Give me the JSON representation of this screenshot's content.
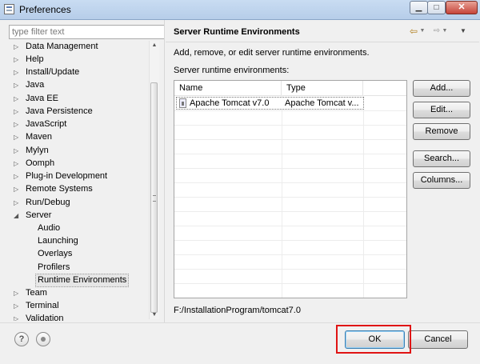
{
  "window": {
    "title": "Preferences",
    "min": "▁",
    "max": "□",
    "close": "✕"
  },
  "filter": {
    "placeholder": "type filter text"
  },
  "tree": {
    "items": [
      {
        "label": "Data Management",
        "arrow": "▷"
      },
      {
        "label": "Help",
        "arrow": "▷"
      },
      {
        "label": "Install/Update",
        "arrow": "▷"
      },
      {
        "label": "Java",
        "arrow": "▷"
      },
      {
        "label": "Java EE",
        "arrow": "▷"
      },
      {
        "label": "Java Persistence",
        "arrow": "▷"
      },
      {
        "label": "JavaScript",
        "arrow": "▷"
      },
      {
        "label": "Maven",
        "arrow": "▷"
      },
      {
        "label": "Mylyn",
        "arrow": "▷"
      },
      {
        "label": "Oomph",
        "arrow": "▷"
      },
      {
        "label": "Plug-in Development",
        "arrow": "▷"
      },
      {
        "label": "Remote Systems",
        "arrow": "▷"
      },
      {
        "label": "Run/Debug",
        "arrow": "▷"
      },
      {
        "label": "Server",
        "arrow": "◢"
      },
      {
        "label": "Audio"
      },
      {
        "label": "Launching"
      },
      {
        "label": "Overlays"
      },
      {
        "label": "Profilers"
      },
      {
        "label": "Runtime Environments"
      },
      {
        "label": "Team",
        "arrow": "▷"
      },
      {
        "label": "Terminal",
        "arrow": "▷"
      },
      {
        "label": "Validation",
        "arrow": "▷"
      }
    ]
  },
  "page": {
    "title": "Server Runtime Environments",
    "description": "Add, remove, or edit server runtime environments.",
    "table_label": "Server runtime environments:",
    "nav": {
      "back": "⇦",
      "fwd": "⇨",
      "drop": "▼",
      "menu": "▼"
    }
  },
  "table": {
    "columns": [
      "Name",
      "Type"
    ],
    "rows": [
      {
        "name": "Apache Tomcat v7.0",
        "type": "Apache Tomcat v..."
      }
    ]
  },
  "buttons": {
    "add": "Add...",
    "edit": "Edit...",
    "remove": "Remove",
    "search": "Search...",
    "columns": "Columns..."
  },
  "install_path": "F:/InstallationProgram/tomcat7.0",
  "footer": {
    "help": "?",
    "ok": "OK",
    "cancel": "Cancel"
  },
  "colors": {
    "highlight": "#e01414",
    "titlebar": "#c9dcf2"
  }
}
